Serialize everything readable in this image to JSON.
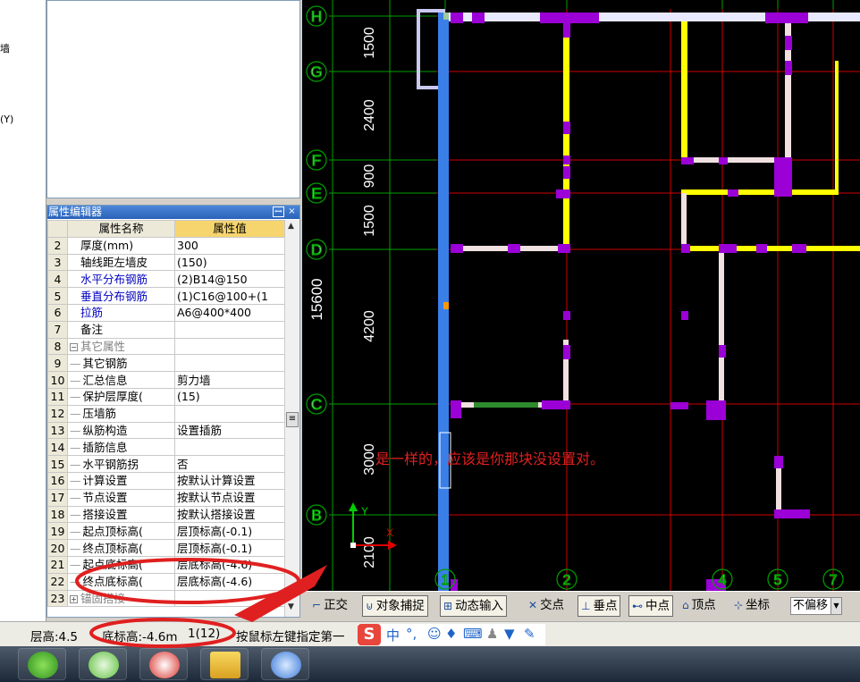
{
  "left_strip": {
    "frag1": "墙",
    "frag2": "(Y)"
  },
  "property_editor": {
    "title": "属性编辑器",
    "pin_icon": "pin-icon",
    "close_label": "×",
    "header": {
      "name": "属性名称",
      "value": "属性值"
    },
    "rows": [
      {
        "num": "2",
        "name": "厚度(mm)",
        "value": "300"
      },
      {
        "num": "3",
        "name": "轴线距左墙皮",
        "value": "(150)"
      },
      {
        "num": "4",
        "name": "水平分布钢筋",
        "value": "(2)B14@150"
      },
      {
        "num": "5",
        "name": "垂直分布钢筋",
        "value": "(1)C16@100+(1"
      },
      {
        "num": "6",
        "name": "拉筋",
        "value": "A6@400*400"
      },
      {
        "num": "7",
        "name": "备注",
        "value": ""
      },
      {
        "num": "8",
        "name": "其它属性",
        "value": ""
      },
      {
        "num": "9",
        "name": "其它钢筋",
        "value": ""
      },
      {
        "num": "10",
        "name": "汇总信息",
        "value": "剪力墙"
      },
      {
        "num": "11",
        "name": "保护层厚度(",
        "value": "(15)"
      },
      {
        "num": "12",
        "name": "压墙筋",
        "value": ""
      },
      {
        "num": "13",
        "name": "纵筋构造",
        "value": "设置插筋"
      },
      {
        "num": "14",
        "name": "插筋信息",
        "value": ""
      },
      {
        "num": "15",
        "name": "水平钢筋拐",
        "value": "否"
      },
      {
        "num": "16",
        "name": "计算设置",
        "value": "按默认计算设置"
      },
      {
        "num": "17",
        "name": "节点设置",
        "value": "按默认节点设置"
      },
      {
        "num": "18",
        "name": "搭接设置",
        "value": "按默认搭接设置"
      },
      {
        "num": "19",
        "name": "起点顶标高(",
        "value": "层顶标高(-0.1)"
      },
      {
        "num": "20",
        "name": "终点顶标高(",
        "value": "层顶标高(-0.1)"
      },
      {
        "num": "21",
        "name": "起点底标高(",
        "value": "层底标高(-4.6)"
      },
      {
        "num": "22",
        "name": "终点底标高(",
        "value": "层底标高(-4.6)"
      },
      {
        "num": "23",
        "name": "锚固搭接",
        "value": ""
      }
    ]
  },
  "cad": {
    "axes_h": [
      {
        "label": "H",
        "dim": "1500"
      },
      {
        "label": "G",
        "dim": "2400"
      },
      {
        "label": "F",
        "dim": "900"
      },
      {
        "label": "E",
        "dim": "1500"
      },
      {
        "label": "D",
        "dim": "4200"
      },
      {
        "label": "C",
        "dim": "3000"
      },
      {
        "label": "B",
        "dim": "2100"
      }
    ],
    "total_dim": "15600",
    "axes_v": [
      "1",
      "2",
      "4",
      "5",
      "7"
    ],
    "ucs_y": "Y",
    "ucs_x": "X",
    "colors": {
      "wall": "#ffff00",
      "column": "#9b00d6",
      "axis": "#d00000",
      "grid": "#00a000",
      "selected": "#3a7fe8"
    }
  },
  "annotation": {
    "text": "是一样的，应该是你那块没设置对。",
    "color": "#e02020"
  },
  "snap_toolbar": {
    "ortho": "正交",
    "object_snap": "对象捕捉",
    "dynamic_input": "动态输入",
    "intersection": "交点",
    "perpendicular": "垂点",
    "midpoint": "中点",
    "vertex": "顶点",
    "coordinate": "坐标",
    "offset": "不偏移"
  },
  "status_bar": {
    "floor_height": "层高:4.5",
    "bottom_elevation": "底标高:-4.6m",
    "count": "1(12)",
    "hint": "按鼠标左键指定第一",
    "ime_lang": "中"
  },
  "taskbar": {
    "apps": [
      "ie-icon",
      "wechat-icon",
      "app-icon",
      "notes-icon",
      "cad-app-icon"
    ]
  }
}
